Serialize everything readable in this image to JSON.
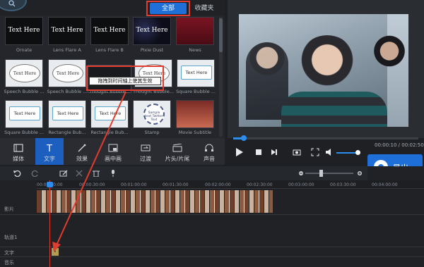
{
  "library": {
    "tabs": {
      "all": "全部",
      "favorites": "收藏夹"
    },
    "tiles": [
      {
        "name": "Ornate",
        "text": "Text Here"
      },
      {
        "name": "Lens Flare A",
        "text": "Text Here"
      },
      {
        "name": "Lens Flare B",
        "text": "Text Here"
      },
      {
        "name": "Pixie Dust",
        "text": "Text Here"
      },
      {
        "name": "News",
        "text": ""
      },
      {
        "name": "Speech Bubble ...",
        "text": "Text Here"
      },
      {
        "name": "Speech Bubble ...",
        "text": "Text Here"
      },
      {
        "name": "Thought Bubble...",
        "text": ""
      },
      {
        "name": "Thought Bubble...",
        "text": "Text Here"
      },
      {
        "name": "Square Bubble ...",
        "text": "Text Here"
      },
      {
        "name": "Square Bubble ...",
        "text": "Text Here"
      },
      {
        "name": "Rectangle Bub...",
        "text": "Text Here"
      },
      {
        "name": "Rectangle Bub...",
        "text": "Text Here"
      },
      {
        "name": "Stamp",
        "text": "Sample text Twitter Text"
      },
      {
        "name": "Movie Subtitle",
        "text": ""
      }
    ],
    "tooltip": "拖拽到时间轴上使其生效"
  },
  "function_tabs": [
    {
      "label": "媒体",
      "icon": "media-icon"
    },
    {
      "label": "文字",
      "icon": "text-icon",
      "active": true
    },
    {
      "label": "效果",
      "icon": "effects-icon"
    },
    {
      "label": "画中画",
      "icon": "pip-icon"
    },
    {
      "label": "过渡",
      "icon": "transition-icon"
    },
    {
      "label": "片头/片尾",
      "icon": "intro-outro-icon"
    },
    {
      "label": "声音",
      "icon": "audio-icon"
    }
  ],
  "preview": {
    "time": "00:00:10 / 00:02:50",
    "progress": 0.06,
    "volume": 0.85
  },
  "export": {
    "label": "导出"
  },
  "timeline": {
    "ruler": [
      "00:00:00:00",
      "00:00:30:00",
      "00:01:00:00",
      "00:01:30:00",
      "00:02:00:00",
      "00:02:30:00",
      "00:03:00:00",
      "00:03:30:00",
      "00:04:00:00"
    ],
    "tracks": [
      "影片",
      "轨道1",
      "文字",
      "音乐"
    ]
  },
  "colors": {
    "accent": "#1f6fd8",
    "highlight": "#e23b2f"
  }
}
